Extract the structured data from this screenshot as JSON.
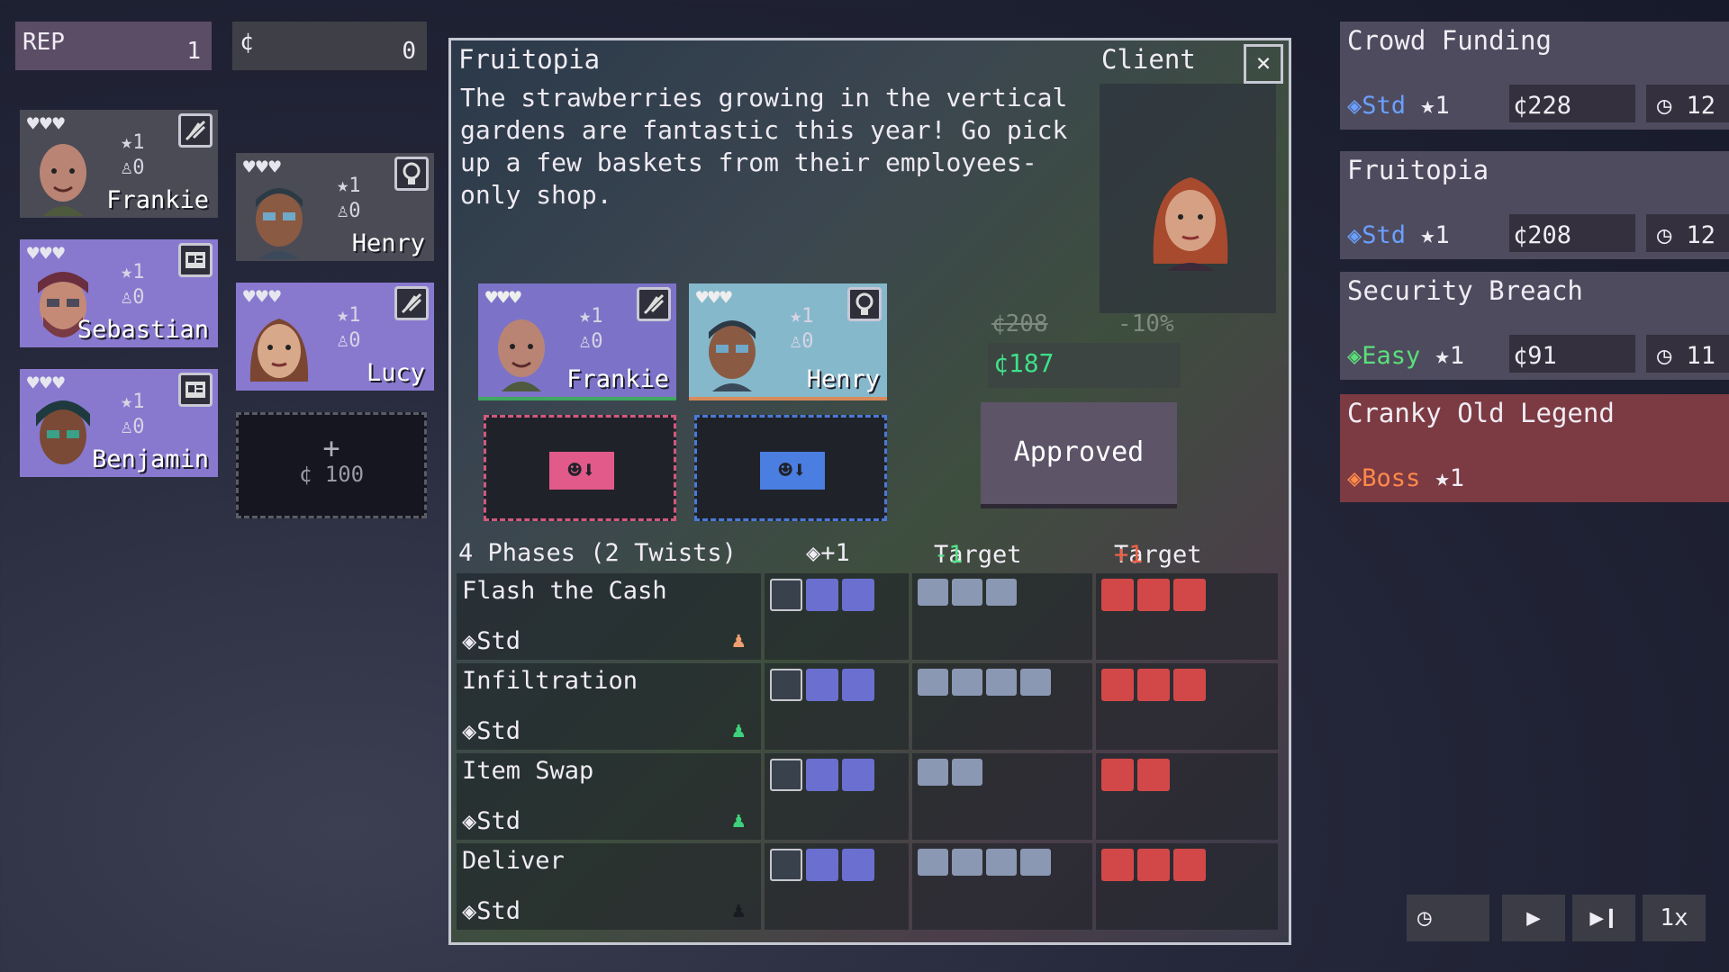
{
  "hud": {
    "rep_label": "REP",
    "rep_value": "1",
    "credit_label": "¢",
    "credit_value": "0"
  },
  "bench": [
    {
      "name": "Frankie",
      "hearts": "♥♥♥",
      "level": "★1",
      "heat": "♙0",
      "role": "feather-icon"
    },
    {
      "name": "Henry",
      "hearts": "♥♥♥",
      "level": "★1",
      "heat": "♙0",
      "role": "bulb-icon"
    },
    {
      "name": "Sebastian",
      "hearts": "♥♥♥",
      "level": "★1",
      "heat": "♙0",
      "role": "card-icon"
    },
    {
      "name": "Lucy",
      "hearts": "♥♥♥",
      "level": "★1",
      "heat": "♙0",
      "role": "feather-icon"
    },
    {
      "name": "Benjamin",
      "hearts": "♥♥♥",
      "level": "★1",
      "heat": "♙0",
      "role": "card-icon"
    }
  ],
  "hire": {
    "plus": "+",
    "cost": "¢ 100"
  },
  "dialog": {
    "title": "Fruitopia",
    "client_label": "Client",
    "close": "×",
    "description": "The strawberries growing in the vertical gardens are fantastic this year! Go pick up a few baskets from their employees-only shop.",
    "team": [
      {
        "name": "Frankie",
        "hearts": "♥♥♥",
        "level": "★1",
        "heat": "♙0"
      },
      {
        "name": "Henry",
        "hearts": "♥♥♥",
        "level": "★1",
        "heat": "♙0"
      }
    ],
    "old_price": "¢208",
    "discount": "-10%",
    "new_price": "¢187",
    "approved": "Approved",
    "phases_header": "4 Phases (2 Twists)",
    "col_bonus": "◈+1",
    "col_target_a": "Target",
    "col_target_a_mod": "-1",
    "col_target_b": "Target",
    "col_target_b_mod": "+1",
    "phases": [
      {
        "name": "Flash the Cash",
        "difficulty": "◈Std",
        "agent_color": "#f0a070"
      },
      {
        "name": "Infiltration",
        "difficulty": "◈Std",
        "agent_color": "#3ed07a"
      },
      {
        "name": "Item Swap",
        "difficulty": "◈Std",
        "agent_color": "#3ed07a"
      },
      {
        "name": "Deliver",
        "difficulty": "◈Std",
        "agent_color": "#1a1a22"
      }
    ]
  },
  "jobs": [
    {
      "name": "Crowd Funding",
      "difficulty": "◈Std",
      "level": "★1",
      "price": "¢228",
      "time": "◷ 12",
      "accent": "#6aa0ff"
    },
    {
      "name": "Fruitopia",
      "difficulty": "◈Std",
      "level": "★1",
      "price": "¢208",
      "time": "◷ 12",
      "accent": "#6aa0ff"
    },
    {
      "name": "Security Breach",
      "difficulty": "◈Easy",
      "level": "★1",
      "price": "¢91",
      "time": "◷ 11",
      "accent": "#5ae07a"
    },
    {
      "name": "Cranky Old Legend",
      "difficulty": "◈Boss",
      "level": "★1",
      "accent": "#ff8a4a"
    }
  ],
  "controls": {
    "clock": "◷",
    "play": "▶",
    "step": "▶❙",
    "speed": "1x"
  }
}
